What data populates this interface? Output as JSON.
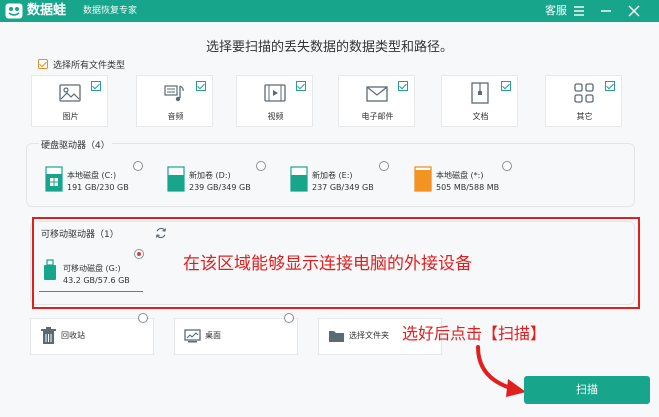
{
  "app": {
    "name": "数据蛙",
    "subtitle": "数据恢复专家",
    "service_label": "客服",
    "brand_color": "#17a68c"
  },
  "main_title": "选择要扫描的丢失数据的数据类型和路径。",
  "select_all_label": "选择所有文件类型",
  "file_types": [
    {
      "label": "图片",
      "icon": "image-icon",
      "checked": true
    },
    {
      "label": "音频",
      "icon": "music-icon",
      "checked": true
    },
    {
      "label": "视频",
      "icon": "video-icon",
      "checked": true
    },
    {
      "label": "电子邮件",
      "icon": "email-icon",
      "checked": true
    },
    {
      "label": "文档",
      "icon": "document-icon",
      "checked": true
    },
    {
      "label": "其它",
      "icon": "other-icon",
      "checked": true
    }
  ],
  "hard_drives": {
    "title": "硬盘驱动器（4）",
    "items": [
      {
        "name": "本地磁盘 (C:)",
        "size": "191 GB/230 GB",
        "icon": "system-drive-icon"
      },
      {
        "name": "新加卷 (D:)",
        "size": "239 GB/349 GB",
        "icon": "drive-icon"
      },
      {
        "name": "新加卷 (E:)",
        "size": "237 GB/349 GB",
        "icon": "drive-icon"
      },
      {
        "name": "本地磁盘 (*:)",
        "size": "505 MB/588 MB",
        "icon": "drive-orange-icon"
      }
    ]
  },
  "removable_drives": {
    "title": "可移动驱动器（1）",
    "items": [
      {
        "name": "可移动磁盘 (G:)",
        "size": "43.2 GB/57.6 GB",
        "icon": "usb-drive-icon",
        "selected": true
      }
    ]
  },
  "locations": [
    {
      "label": "回收站",
      "icon": "recycle-bin-icon"
    },
    {
      "label": "桌面",
      "icon": "desktop-icon"
    },
    {
      "label": "选择文件夹",
      "icon": "folder-icon"
    }
  ],
  "annotations": {
    "removable_note": "在该区域能够显示连接电脑的外接设备",
    "scan_note": "选好后点击【扫描】"
  },
  "scan_button_label": "扫描"
}
